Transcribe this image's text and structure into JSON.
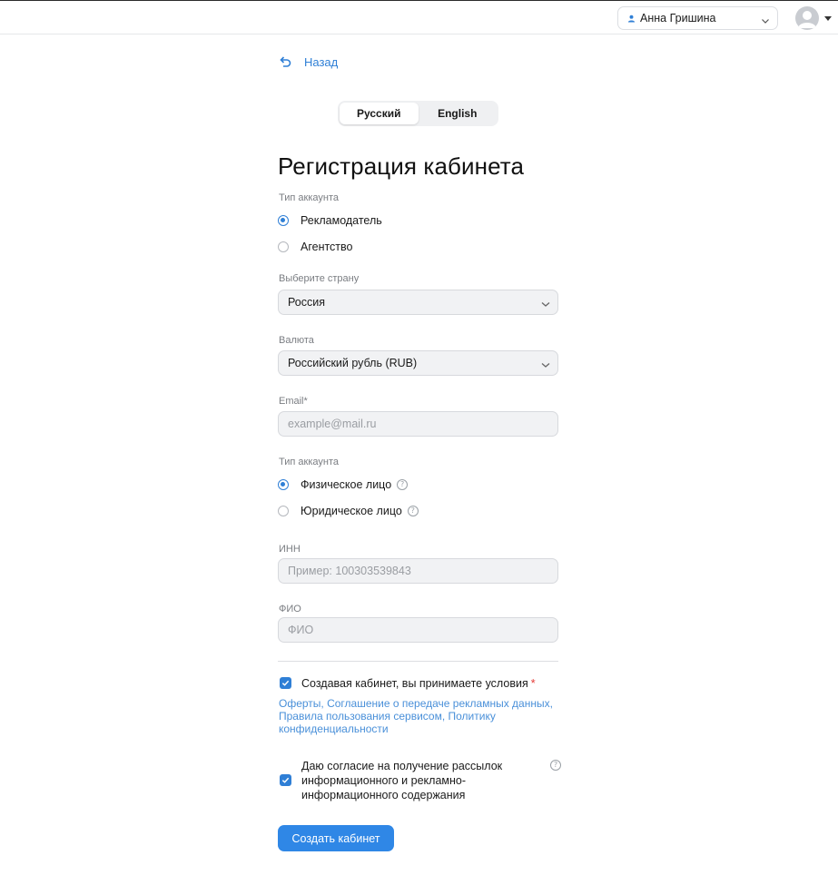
{
  "header": {
    "user_name": "Анна Гришина"
  },
  "back": {
    "label": "Назад"
  },
  "language": {
    "options": [
      "Русский",
      "English"
    ],
    "selected": "Русский"
  },
  "page_title": "Регистрация кабинета",
  "account_type": {
    "label": "Тип аккаунта",
    "options": [
      "Рекламодатель",
      "Агентство"
    ],
    "selected": "Рекламодатель"
  },
  "country": {
    "label": "Выберите страну",
    "value": "Россия"
  },
  "currency": {
    "label": "Валюта",
    "value": "Российский рубль (RUB)"
  },
  "email": {
    "label": "Email*",
    "placeholder": "example@mail.ru"
  },
  "legal_type": {
    "label": "Тип аккаунта",
    "options": [
      "Физическое лицо",
      "Юридическое лицо"
    ],
    "selected": "Физическое лицо",
    "help_glyph": "?"
  },
  "inn": {
    "label": "ИНН",
    "placeholder": "Пример: 100303539843"
  },
  "fio": {
    "label": "ФИО",
    "placeholder": "ФИО"
  },
  "terms": {
    "checked": true,
    "text": "Создавая кабинет, вы принимаете условия",
    "required_mark": "*",
    "links": [
      "Оферты",
      "Соглашение о передаче рекламных данных",
      "Правила пользования сервисом",
      "Политику конфиденциальности"
    ],
    "separator": ", "
  },
  "consent": {
    "checked": true,
    "text": "Даю согласие на получение рассылок информационного и рекламно-информационного содержания"
  },
  "submit": {
    "label": "Создать кабинет"
  },
  "colors": {
    "accent": "#2f7fd6",
    "button": "#2f87e6",
    "link": "#4a90d9",
    "field_bg": "#f1f2f4"
  }
}
